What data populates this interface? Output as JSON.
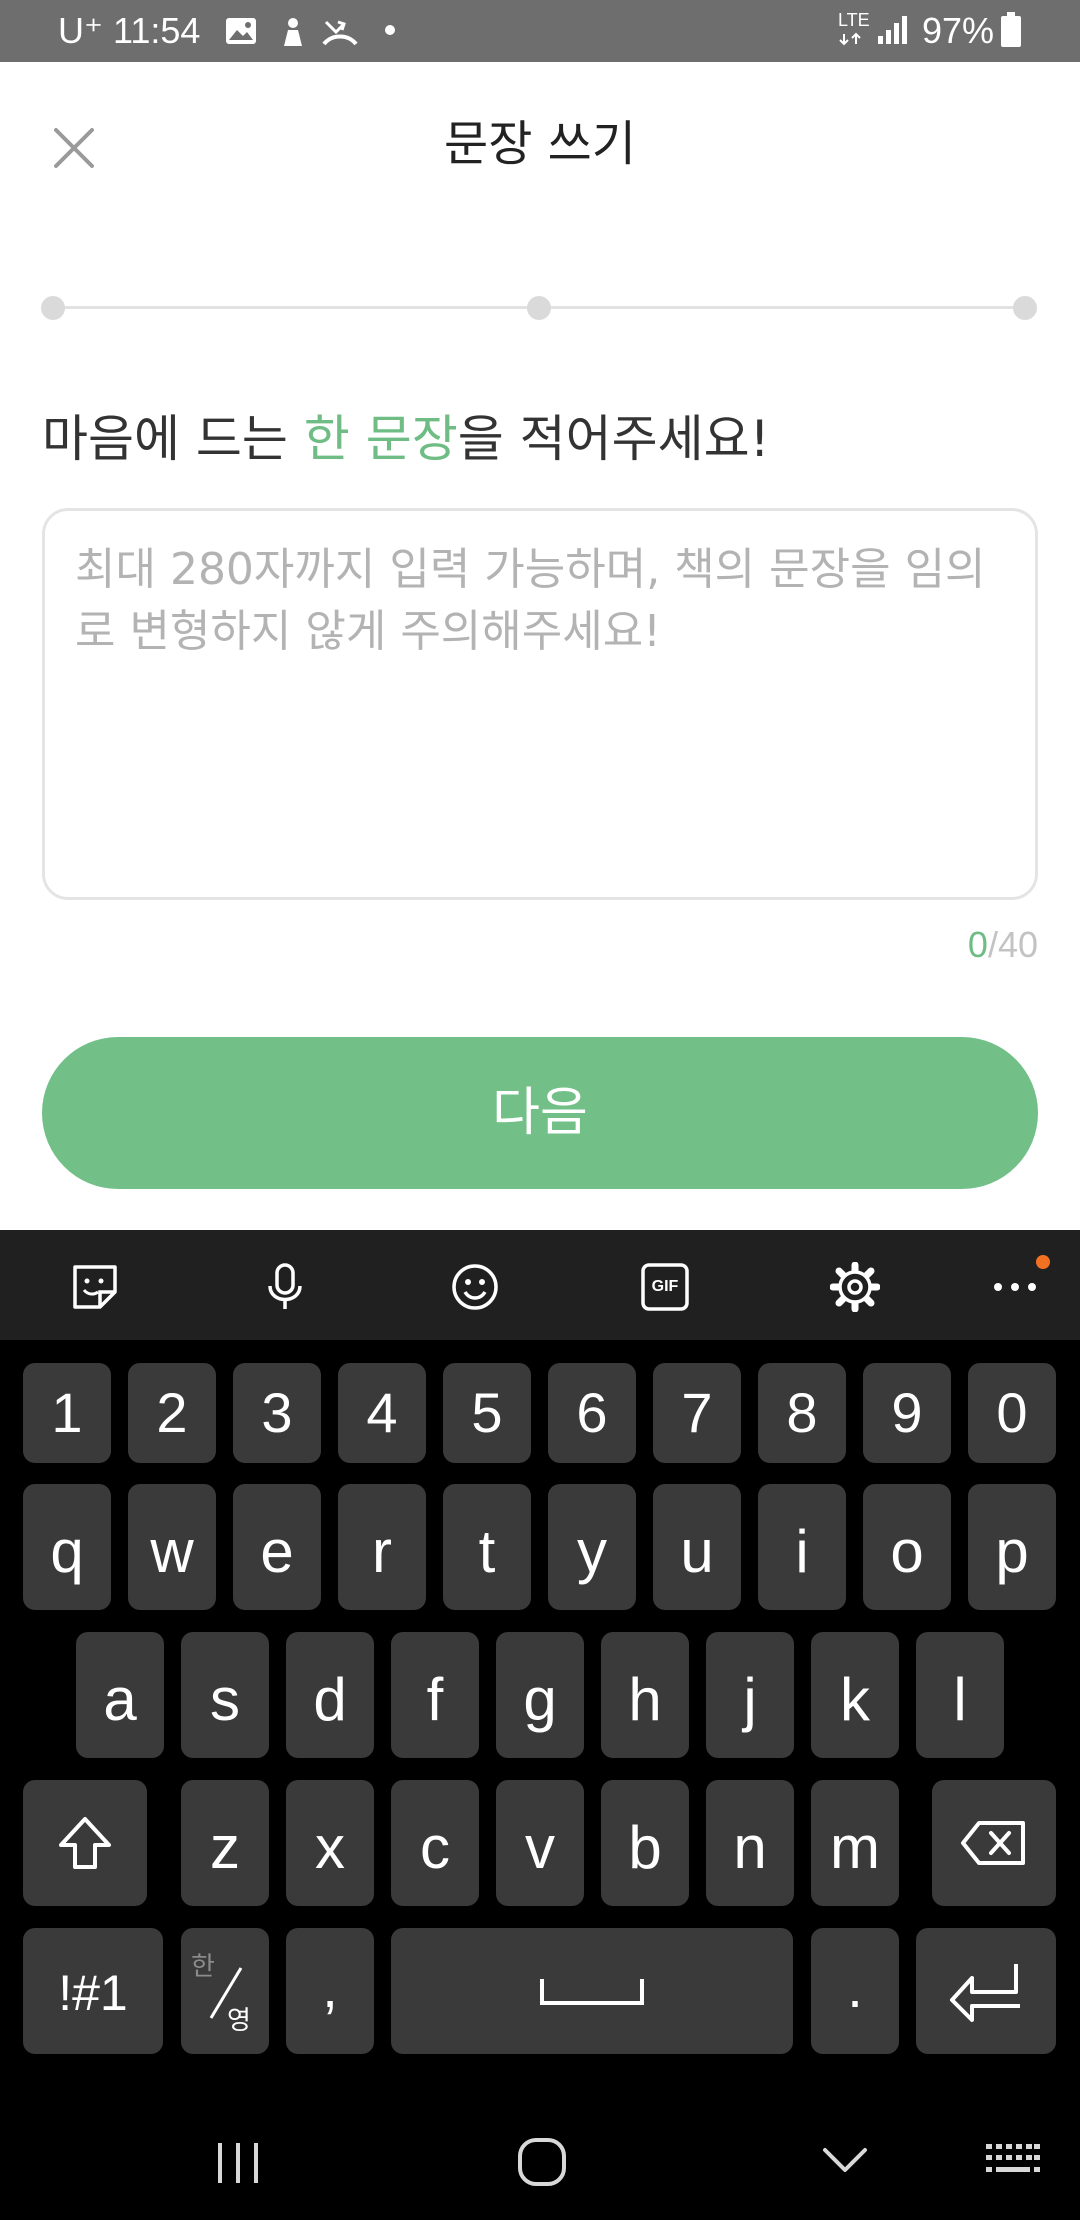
{
  "status_bar": {
    "carrier": "U⁺",
    "time": "11:54",
    "network": "LTE",
    "battery": "97%"
  },
  "header": {
    "title": "문장 쓰기",
    "close_icon": "close-icon"
  },
  "progress": {
    "steps": 3
  },
  "prompt": {
    "before": "마음에 드는 ",
    "highlight": "한 문장",
    "after": "을 적어주세요!",
    "highlight_color": "#6fbd85"
  },
  "sentence_input": {
    "value": "",
    "placeholder": "최대 280자까지 입력 가능하며, 책의 문장을 임의로 변형하지 않게 주의해주세요!"
  },
  "counter": {
    "current": "0",
    "max": "/40"
  },
  "next_button": {
    "label": "다음",
    "color": "#72c088"
  },
  "keyboard": {
    "toolbar": [
      "sticker-icon",
      "microphone-icon",
      "emoji-icon",
      "gif-icon",
      "settings-icon",
      "more-icon"
    ],
    "gif_label": "GIF",
    "row_numbers": [
      "1",
      "2",
      "3",
      "4",
      "5",
      "6",
      "7",
      "8",
      "9",
      "0"
    ],
    "row1": [
      "q",
      "w",
      "e",
      "r",
      "t",
      "y",
      "u",
      "i",
      "o",
      "p"
    ],
    "row2": [
      "a",
      "s",
      "d",
      "f",
      "g",
      "h",
      "j",
      "k",
      "l"
    ],
    "row3": [
      "z",
      "x",
      "c",
      "v",
      "b",
      "n",
      "m"
    ],
    "symbols_label": "!#1",
    "lang_top": "한",
    "lang_bottom": "영",
    "comma": ",",
    "period": "."
  },
  "nav_bar": [
    "recent-apps-icon",
    "home-icon",
    "back-icon",
    "keyboard-switch-icon"
  ]
}
